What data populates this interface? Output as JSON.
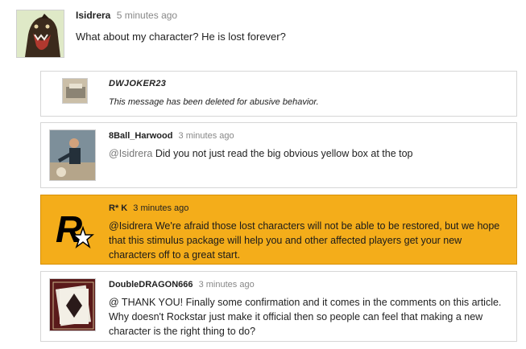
{
  "comments": {
    "top": {
      "username": "Isidrera",
      "timestamp": "5 minutes ago",
      "text": "What about my character? He is lost forever?"
    },
    "reply1": {
      "username": "DWJOKER23",
      "text": "This message has been deleted for abusive behavior."
    },
    "reply2": {
      "username": "8Ball_Harwood",
      "timestamp": "3 minutes ago",
      "mention": "@Isidrera",
      "text": "Did you not just read the big obvious yellow box at the top"
    },
    "reply3": {
      "username": "R* K",
      "timestamp": "3 minutes ago",
      "mention": "@Isidrera",
      "text": "We're afraid those lost characters will not be able to be restored, but we hope that this stimulus package will help you and other affected players get your new characters off to a great start."
    },
    "reply4": {
      "username": "DoubleDRAGON666",
      "timestamp": "3 minutes ago",
      "text": "@ THANK YOU! Finally some confirmation and it comes in the comments on this article. Why doesn't Rockstar just make it official then so people can feel that making a new character is the right thing to do?"
    }
  },
  "colors": {
    "official_bg": "#f4ad1a",
    "border": "#d6d6d6"
  }
}
